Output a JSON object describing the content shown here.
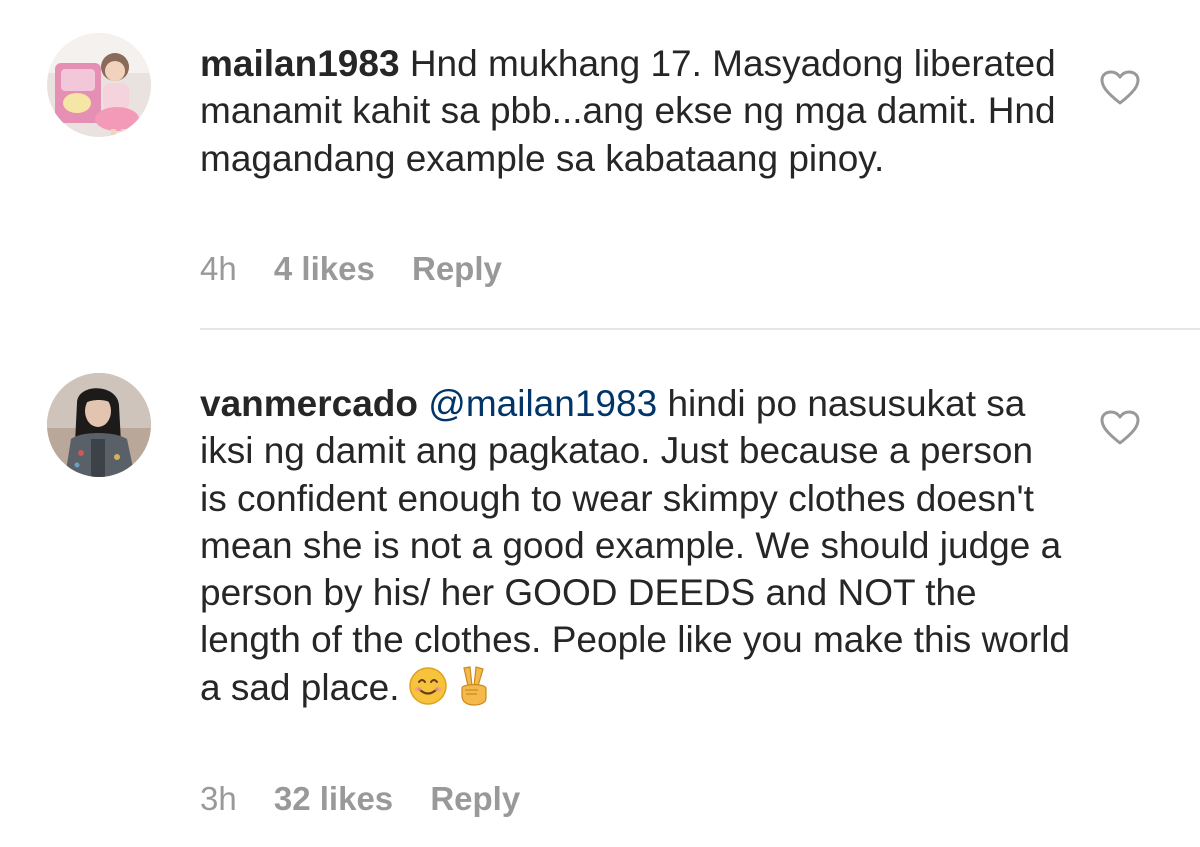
{
  "comments": [
    {
      "username": "mailan1983",
      "text": "Hnd mukhang 17. Masyadong liberated manamit kahit sa pbb...ang ekse ng mga damit. Hnd magandang example sa kabataang pinoy.",
      "time": "4h",
      "likes": "4 likes",
      "reply": "Reply",
      "avatar_icon": "avatar-photo-child"
    },
    {
      "username": "vanmercado",
      "mention": "@mailan1983",
      "text": "hindi po nasusukat sa iksi ng damit ang pagkatao. Just because a person is confident enough to wear skimpy clothes doesn't mean she is not a good example. We should judge a person by his/ her GOOD DEEDS and NOT the length of the clothes. People like you make this world a sad place.",
      "emojis": [
        "smiling-face-emoji",
        "victory-hand-emoji"
      ],
      "time": "3h",
      "likes": "32 likes",
      "reply": "Reply",
      "avatar_icon": "avatar-photo-woman"
    }
  ],
  "colors": {
    "text": "#262626",
    "mention": "#003569",
    "meta": "#999999",
    "divider": "#e6e6e6"
  },
  "icons": {
    "like": "heart-outline-icon"
  }
}
